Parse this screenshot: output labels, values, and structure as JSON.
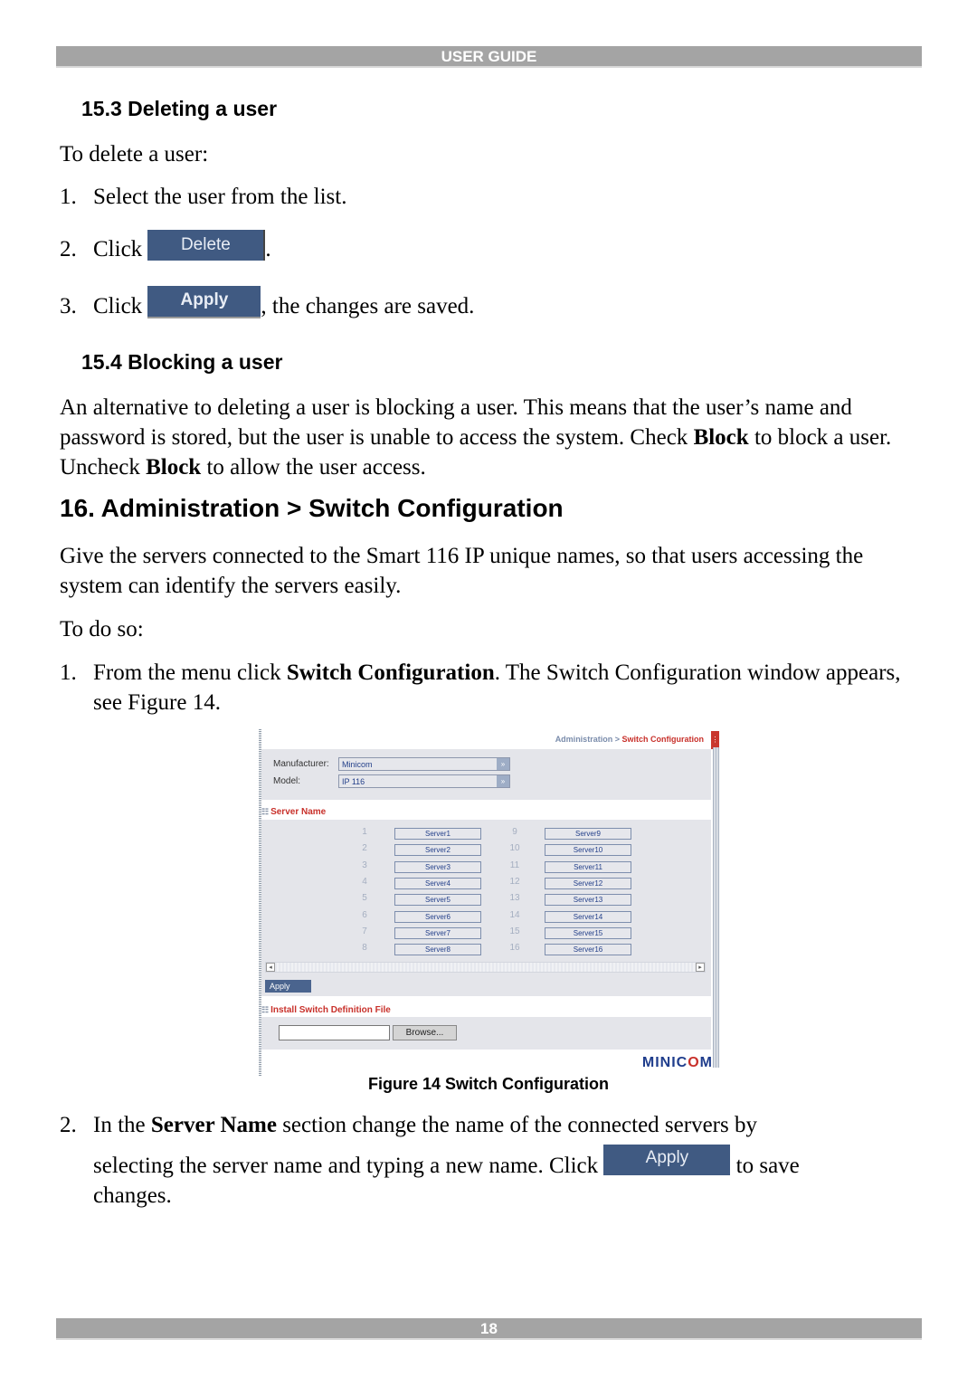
{
  "header": {
    "title": "USER GUIDE"
  },
  "section_15_3": {
    "heading": "15.3 Deleting a user",
    "intro": "To delete a user:",
    "steps": [
      {
        "num": "1.",
        "text": "Select the user from the list."
      },
      {
        "num": "2.",
        "text_before": "Click",
        "button": "Delete",
        "text_after": "."
      },
      {
        "num": "3.",
        "text_before": "Click",
        "button": "Apply",
        "text_after": ", the changes are saved."
      }
    ]
  },
  "section_15_4": {
    "heading": "15.4 Blocking a user",
    "para_parts": [
      "An alternative to deleting a user is blocking a user. This means that the user’s name and password is stored, but the user is unable to access the system. Check ",
      "Block",
      " to block a user. Uncheck ",
      "Block",
      " to allow the user access."
    ]
  },
  "section_16": {
    "heading": "16. Administration > Switch Configuration",
    "para": "Give the servers connected to the Smart 116 IP unique names, so that users accessing the system can identify the servers easily.",
    "todo": "To do so:",
    "step1": {
      "num": "1.",
      "before": "From the menu click ",
      "bold": "Switch Configuration",
      "after": ". The Switch Configuration window appears, see Figure 14."
    },
    "step2": {
      "num": "2.",
      "before": "In the ",
      "bold": "Server Name",
      "after": " section change the name of the connected servers by",
      "line2_before": "selecting the server name and typing a new name. Click",
      "button": "Apply",
      "line2_after": "to save",
      "line3": "changes."
    }
  },
  "figure": {
    "breadcrumb_parent": "Administration",
    "breadcrumb_sep": ">",
    "breadcrumb_current": "Switch Configuration",
    "manufacturer_label": "Manufacturer:",
    "manufacturer_value": "Minicom",
    "model_label": "Model:",
    "model_value": "IP 116",
    "server_name_heading": "Server Name",
    "servers": [
      {
        "num": "1",
        "name": "Server1"
      },
      {
        "num": "2",
        "name": "Server2"
      },
      {
        "num": "3",
        "name": "Server3"
      },
      {
        "num": "4",
        "name": "Server4"
      },
      {
        "num": "5",
        "name": "Server5"
      },
      {
        "num": "6",
        "name": "Server6"
      },
      {
        "num": "7",
        "name": "Server7"
      },
      {
        "num": "8",
        "name": "Server8"
      },
      {
        "num": "9",
        "name": "Server9"
      },
      {
        "num": "10",
        "name": "Server10"
      },
      {
        "num": "11",
        "name": "Server11"
      },
      {
        "num": "12",
        "name": "Server12"
      },
      {
        "num": "13",
        "name": "Server13"
      },
      {
        "num": "14",
        "name": "Server14"
      },
      {
        "num": "15",
        "name": "Server15"
      },
      {
        "num": "16",
        "name": "Server16"
      }
    ],
    "apply_label": "Apply",
    "install_heading": "Install Switch Definition File",
    "file_value": "",
    "browse_label": "Browse...",
    "logo_left": "MINIC",
    "logo_o": "O",
    "logo_right": "M",
    "caption": "Figure 14 Switch Configuration"
  },
  "footer": {
    "page_number": "18"
  }
}
